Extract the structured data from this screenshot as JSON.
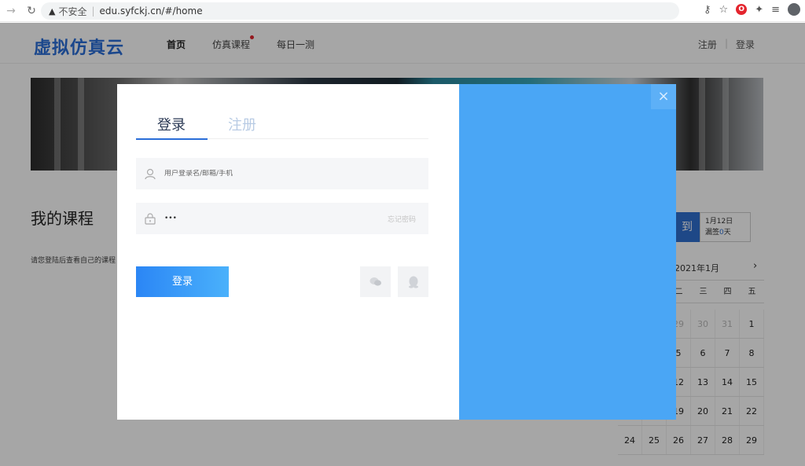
{
  "browser": {
    "insecure_label": "不安全",
    "url": "edu.syfckj.cn/#/home"
  },
  "site": {
    "logo": "虚拟仿真云",
    "nav": [
      "首页",
      "仿真课程",
      "每日一测"
    ],
    "register": "注册",
    "login": "登录"
  },
  "page": {
    "my_courses_title": "我的课程",
    "login_hint": "请您登陆后查看自己的课程",
    "signin_button": "到",
    "signin_date": "1月12日",
    "signin_prefix": "漏签",
    "signin_count": "0",
    "signin_suffix": "天",
    "calendar_month": "2021年1月",
    "calendar_next": "›",
    "weekday_headers": [
      "二",
      "三",
      "四",
      "五"
    ],
    "calendar_rows": [
      [
        "",
        "",
        "29",
        "30",
        "31",
        "1"
      ],
      [
        "",
        "",
        "5",
        "6",
        "7",
        "8"
      ],
      [
        "",
        "",
        "12",
        "13",
        "14",
        "15"
      ],
      [
        "",
        "",
        "19",
        "20",
        "21",
        "22"
      ],
      [
        "24",
        "25",
        "26",
        "27",
        "28",
        "29"
      ]
    ]
  },
  "modal": {
    "tab_login": "登录",
    "tab_register": "注册",
    "username_placeholder": "用户登录名/邮箱/手机",
    "password_value": "•••",
    "forgot_password": "忘记密码",
    "login_button": "登录",
    "close_symbol": "×"
  },
  "colors": {
    "brand_blue": "#2a6ed8",
    "panel_blue": "#4aa6f5"
  }
}
